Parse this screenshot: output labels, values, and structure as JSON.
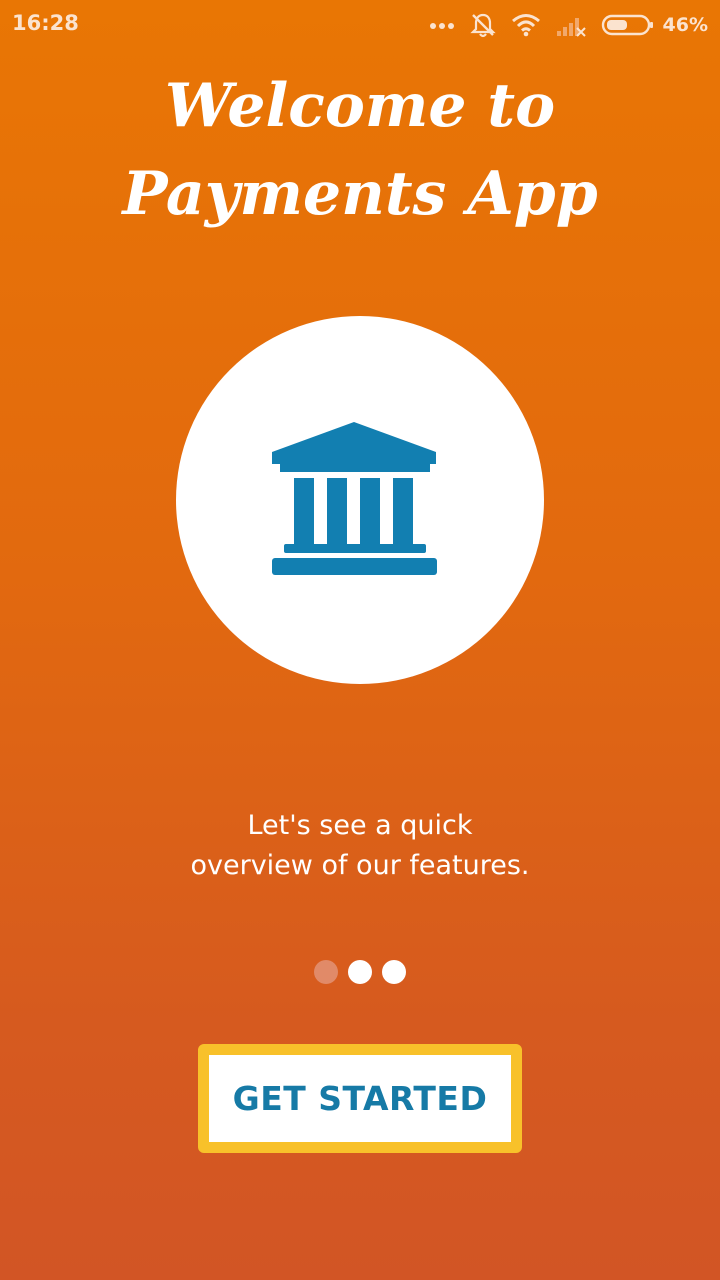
{
  "status_bar": {
    "time": "16:28",
    "battery_percent": "46%",
    "icons": [
      "more-dots-icon",
      "alarm-off-icon",
      "wifi-icon",
      "no-signal-icon",
      "battery-icon"
    ]
  },
  "welcome": {
    "title_line1": "Welcome to",
    "title_line2": "Payments App"
  },
  "hero": {
    "icon": "bank-icon",
    "icon_color": "#127fb1"
  },
  "description": {
    "line1": "Let's see a quick",
    "line2": "overview of our features."
  },
  "pager": {
    "total": 3,
    "active_index": 0
  },
  "cta": {
    "label": "GET STARTED",
    "border_color": "#f8c12a",
    "text_color": "#167aa6"
  },
  "colors": {
    "background_top": "#e97604",
    "background_bottom": "#d25525"
  }
}
